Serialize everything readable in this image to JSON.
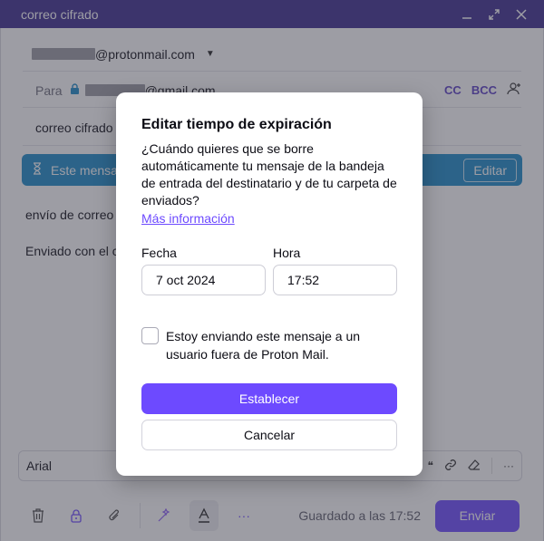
{
  "window": {
    "title": "correo cifrado",
    "title_color": "#3c2d8f"
  },
  "composer": {
    "from_address": "@protonmail.com",
    "to_label": "Para",
    "to_address": "@gmail.com",
    "cc_label": "CC",
    "bcc_label": "BCC",
    "subject": "correo cifrado",
    "banner_text": "Este mensaj",
    "banner_edit": "Editar",
    "body_line1": "envío de correo c",
    "body_line2": "Enviado con el co",
    "font_name": "Arial",
    "toolbar_more": "···",
    "saved_status": "Guardado a las 17:52",
    "send_label": "Enviar",
    "accent_color": "#6d4aff",
    "banner_color": "#1c8bc9"
  },
  "modal": {
    "title": "Editar tiempo de expiración",
    "description": "¿Cuándo quieres que se borre automáticamente tu mensaje de la bandeja de entrada del destinatario y de tu carpeta de enviados?",
    "link": "Más información",
    "date_label": "Fecha",
    "date_value": "7 oct 2024",
    "time_label": "Hora",
    "time_value": "17:52",
    "checkbox_label": "Estoy enviando este mensaje a un usuario fuera de Proton Mail.",
    "checkbox_checked": false,
    "primary_button": "Establecer",
    "secondary_button": "Cancelar"
  }
}
